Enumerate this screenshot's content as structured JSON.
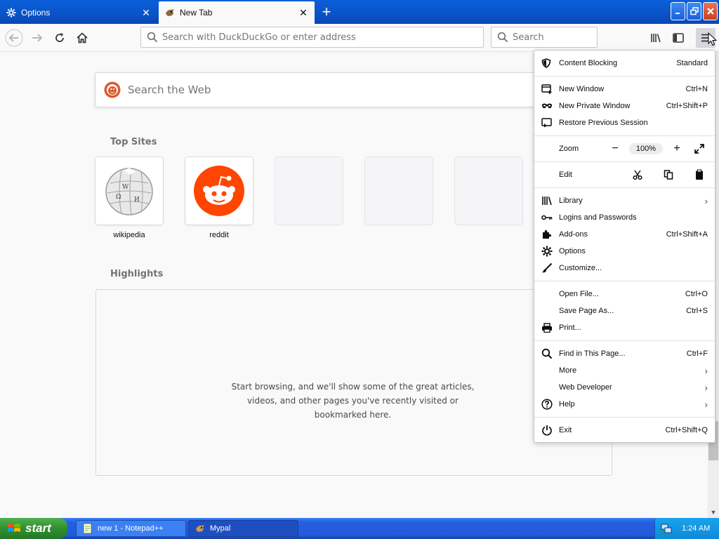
{
  "tabs": [
    {
      "label": "Options",
      "icon": "gear-icon",
      "active": false
    },
    {
      "label": "New Tab",
      "icon": "mypal-icon",
      "active": true
    }
  ],
  "navbar": {
    "url_placeholder": "Search with DuckDuckGo or enter address",
    "search_placeholder": "Search"
  },
  "content": {
    "web_search_placeholder": "Search the Web",
    "top_sites_title": "Top Sites",
    "top_sites": [
      {
        "label": "wikipedia"
      },
      {
        "label": "reddit"
      },
      {
        "label": ""
      },
      {
        "label": ""
      },
      {
        "label": ""
      }
    ],
    "highlights_title": "Highlights",
    "highlights_message": "Start browsing, and we'll show some of the great articles, videos, and other pages you've recently visited or bookmarked here."
  },
  "appmenu": {
    "content_blocking": {
      "label": "Content Blocking",
      "value": "Standard"
    },
    "new_window": {
      "label": "New Window",
      "shortcut": "Ctrl+N"
    },
    "new_private_window": {
      "label": "New Private Window",
      "shortcut": "Ctrl+Shift+P"
    },
    "restore_session": {
      "label": "Restore Previous Session"
    },
    "zoom": {
      "label": "Zoom",
      "minus": "−",
      "level": "100%",
      "plus": "+"
    },
    "edit": {
      "label": "Edit"
    },
    "library": {
      "label": "Library"
    },
    "logins": {
      "label": "Logins and Passwords"
    },
    "addons": {
      "label": "Add-ons",
      "shortcut": "Ctrl+Shift+A"
    },
    "options": {
      "label": "Options"
    },
    "customize": {
      "label": "Customize..."
    },
    "open_file": {
      "label": "Open File...",
      "shortcut": "Ctrl+O"
    },
    "save_page": {
      "label": "Save Page As...",
      "shortcut": "Ctrl+S"
    },
    "print": {
      "label": "Print..."
    },
    "find": {
      "label": "Find in This Page...",
      "shortcut": "Ctrl+F"
    },
    "more": {
      "label": "More"
    },
    "web_developer": {
      "label": "Web Developer"
    },
    "help": {
      "label": "Help"
    },
    "exit": {
      "label": "Exit",
      "shortcut": "Ctrl+Shift+Q"
    }
  },
  "taskbar": {
    "start_label": "start",
    "tasks": [
      {
        "label": "new 1 - Notepad++"
      },
      {
        "label": "Mypal"
      }
    ],
    "clock": "1:24 AM"
  },
  "colors": {
    "accent": "#0a84ff",
    "reddit": "#ff4500",
    "titlebar": "#0a53c8",
    "taskbar": "#245ee0",
    "start_green": "#2f8f2f"
  }
}
